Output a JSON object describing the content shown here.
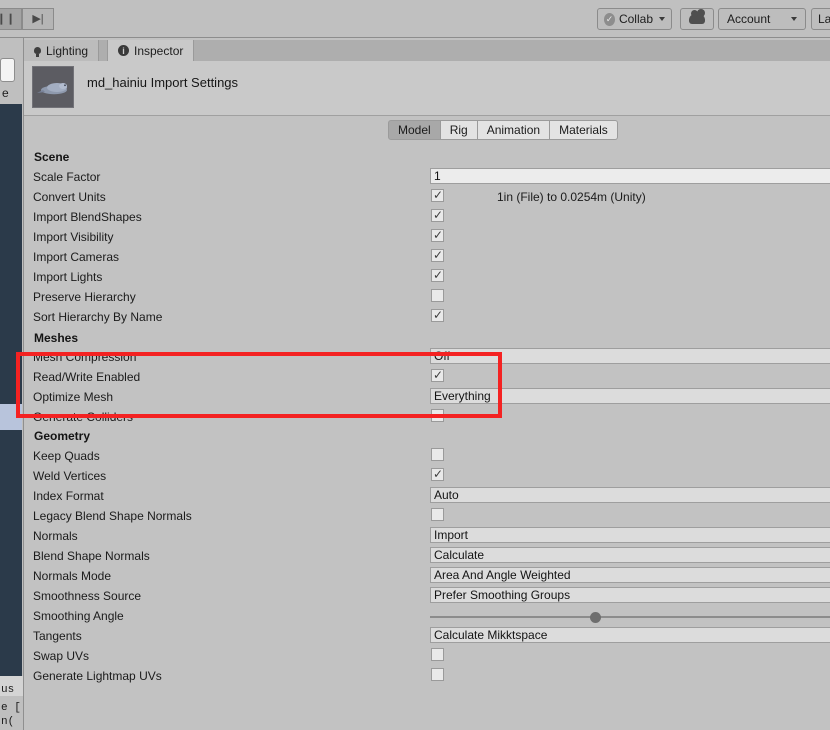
{
  "window": {
    "app": "Unity Editor",
    "background_color": "#c2c2c2"
  },
  "toolbar": {
    "pause_button": "❙❙",
    "step_button": "▶|",
    "collab_label": "Collab",
    "collab_icon": "check-circle-icon",
    "cloud_icon": "cloud-icon",
    "account_label": "Account",
    "layout_label": "Lay",
    "accent_color": "#f42222"
  },
  "tabs": [
    {
      "label": "Lighting",
      "icon": "light-bulb-icon",
      "active": false
    },
    {
      "label": "Inspector",
      "icon": "info-icon",
      "active": true
    }
  ],
  "inspector": {
    "title": "md_hainiu Import Settings",
    "thumbnail_icon": "seagull-model-thumbnail"
  },
  "subtabs": [
    {
      "label": "Model",
      "selected": true
    },
    {
      "label": "Rig",
      "selected": false
    },
    {
      "label": "Animation",
      "selected": false
    },
    {
      "label": "Materials",
      "selected": false
    }
  ],
  "sections": [
    {
      "title": "Scene",
      "rows": [
        {
          "label": "Scale Factor",
          "type": "text",
          "value": "1"
        },
        {
          "label": "Convert Units",
          "type": "checkbox",
          "checked": true,
          "note": "1in (File) to 0.0254m (Unity)"
        },
        {
          "label": "Import BlendShapes",
          "type": "checkbox",
          "checked": true
        },
        {
          "label": "Import Visibility",
          "type": "checkbox",
          "checked": true
        },
        {
          "label": "Import Cameras",
          "type": "checkbox",
          "checked": true
        },
        {
          "label": "Import Lights",
          "type": "checkbox",
          "checked": true
        },
        {
          "label": "Preserve Hierarchy",
          "type": "checkbox",
          "checked": false
        },
        {
          "label": "Sort Hierarchy By Name",
          "type": "checkbox",
          "checked": true
        }
      ]
    },
    {
      "title": "Meshes",
      "rows": [
        {
          "label": "Mesh Compression",
          "type": "popup",
          "value": "Off"
        },
        {
          "label": "Read/Write Enabled",
          "type": "checkbox",
          "checked": true
        },
        {
          "label": "Optimize Mesh",
          "type": "popup",
          "value": "Everything"
        },
        {
          "label": "Generate Colliders",
          "type": "checkbox",
          "checked": false
        }
      ]
    },
    {
      "title": "Geometry",
      "rows": [
        {
          "label": "Keep Quads",
          "type": "checkbox",
          "checked": false
        },
        {
          "label": "Weld Vertices",
          "type": "checkbox",
          "checked": true
        },
        {
          "label": "Index Format",
          "type": "popup",
          "value": "Auto"
        },
        {
          "label": "Legacy Blend Shape Normals",
          "type": "checkbox",
          "checked": false
        },
        {
          "label": "Normals",
          "type": "popup",
          "value": "Import"
        },
        {
          "label": "Blend Shape Normals",
          "type": "popup",
          "value": "Calculate"
        },
        {
          "label": "Normals Mode",
          "type": "popup",
          "value": "Area And Angle Weighted"
        },
        {
          "label": "Smoothness Source",
          "type": "popup",
          "value": "Prefer Smoothing Groups"
        },
        {
          "label": "Smoothing Angle",
          "type": "slider",
          "knob_percent": 39
        },
        {
          "label": "Tangents",
          "type": "popup",
          "value": "Calculate Mikktspace"
        },
        {
          "label": "Swap UVs",
          "type": "checkbox",
          "checked": false
        },
        {
          "label": "Generate Lightmap UVs",
          "type": "checkbox",
          "checked": false
        }
      ]
    }
  ],
  "left_edge": {
    "code_fragments": [
      "us",
      "e [",
      "n("
    ],
    "label_e": "e"
  },
  "annotation": {
    "color": "#f42222",
    "highlights": [
      "Read/Write Enabled",
      "Optimize Mesh"
    ]
  }
}
